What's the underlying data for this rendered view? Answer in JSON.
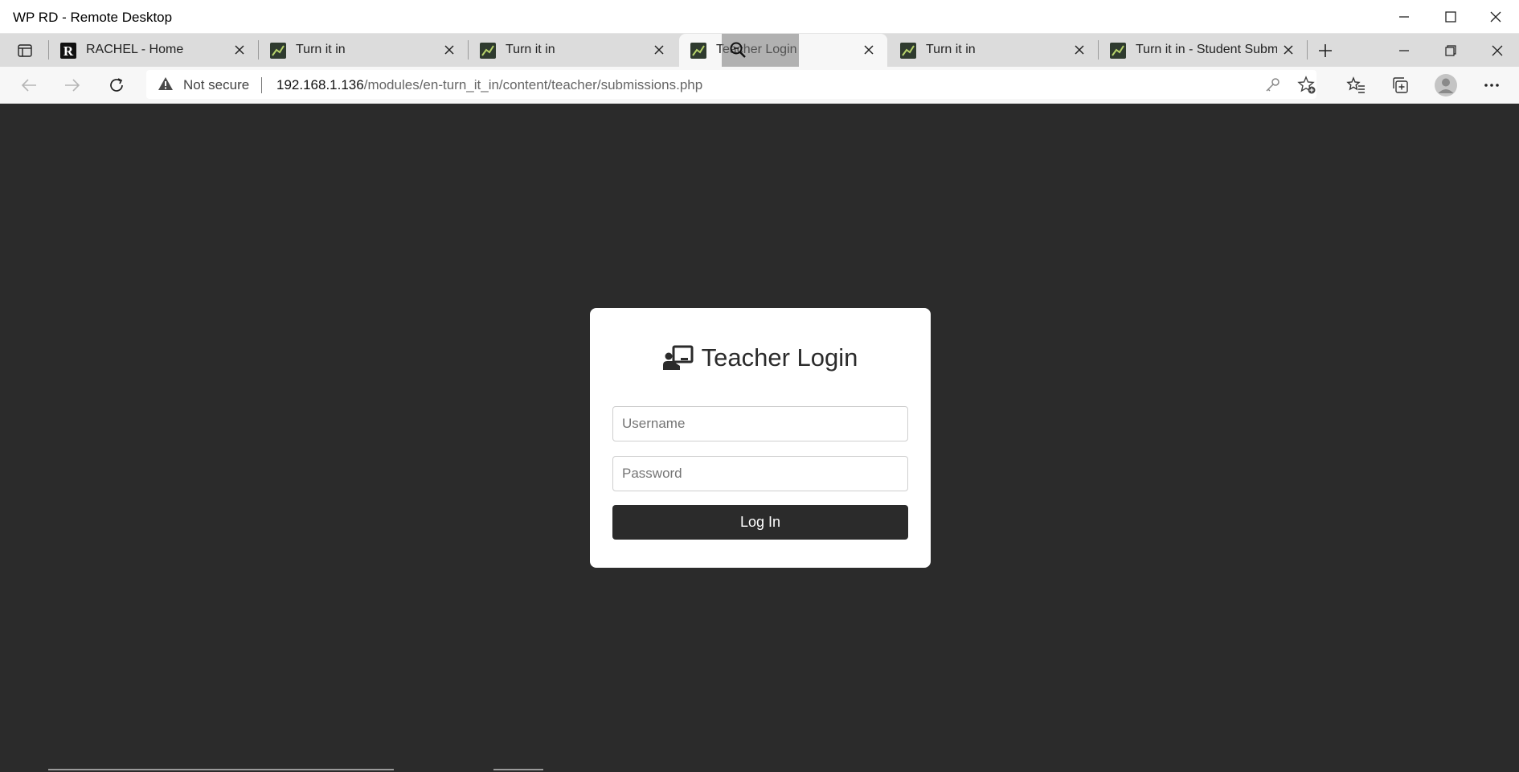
{
  "window": {
    "title": "WP RD - Remote Desktop"
  },
  "tabs": [
    {
      "label": "RACHEL - Home",
      "favicon": "rachel-r-icon",
      "active": false
    },
    {
      "label": "Turn it in",
      "favicon": "turn-it-in-icon",
      "active": false
    },
    {
      "label": "Turn it in",
      "favicon": "turn-it-in-icon",
      "active": false
    },
    {
      "label": "Teacher Login",
      "favicon": "turn-it-in-icon",
      "active": true
    },
    {
      "label": "Turn it in",
      "favicon": "turn-it-in-icon",
      "active": false
    },
    {
      "label": "Turn it in - Student Submis",
      "favicon": "turn-it-in-icon",
      "active": false
    }
  ],
  "address_bar": {
    "security_label": "Not secure",
    "url_host": "192.168.1.136",
    "url_path": "/modules/en-turn_it_in/content/teacher/submissions.php"
  },
  "login": {
    "title": "Teacher Login",
    "username_placeholder": "Username",
    "username_value": "",
    "password_placeholder": "Password",
    "password_value": "",
    "button_label": "Log In"
  },
  "colors": {
    "page_background": "#2b2b2b",
    "card_background": "#ffffff",
    "button_background": "#2b2b2b"
  }
}
